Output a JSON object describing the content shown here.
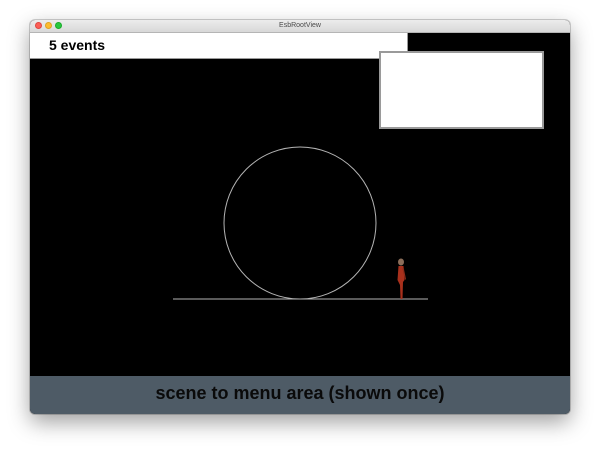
{
  "window": {
    "title": "EsbRootView"
  },
  "events_bar": {
    "label": "5 events"
  },
  "scene": {
    "background": "#000000",
    "line_color": "#b4b4b4",
    "figure_color": "#a8301c"
  },
  "bottom_bar": {
    "label": "scene to menu area (shown once)",
    "color": "#4e5b66"
  }
}
